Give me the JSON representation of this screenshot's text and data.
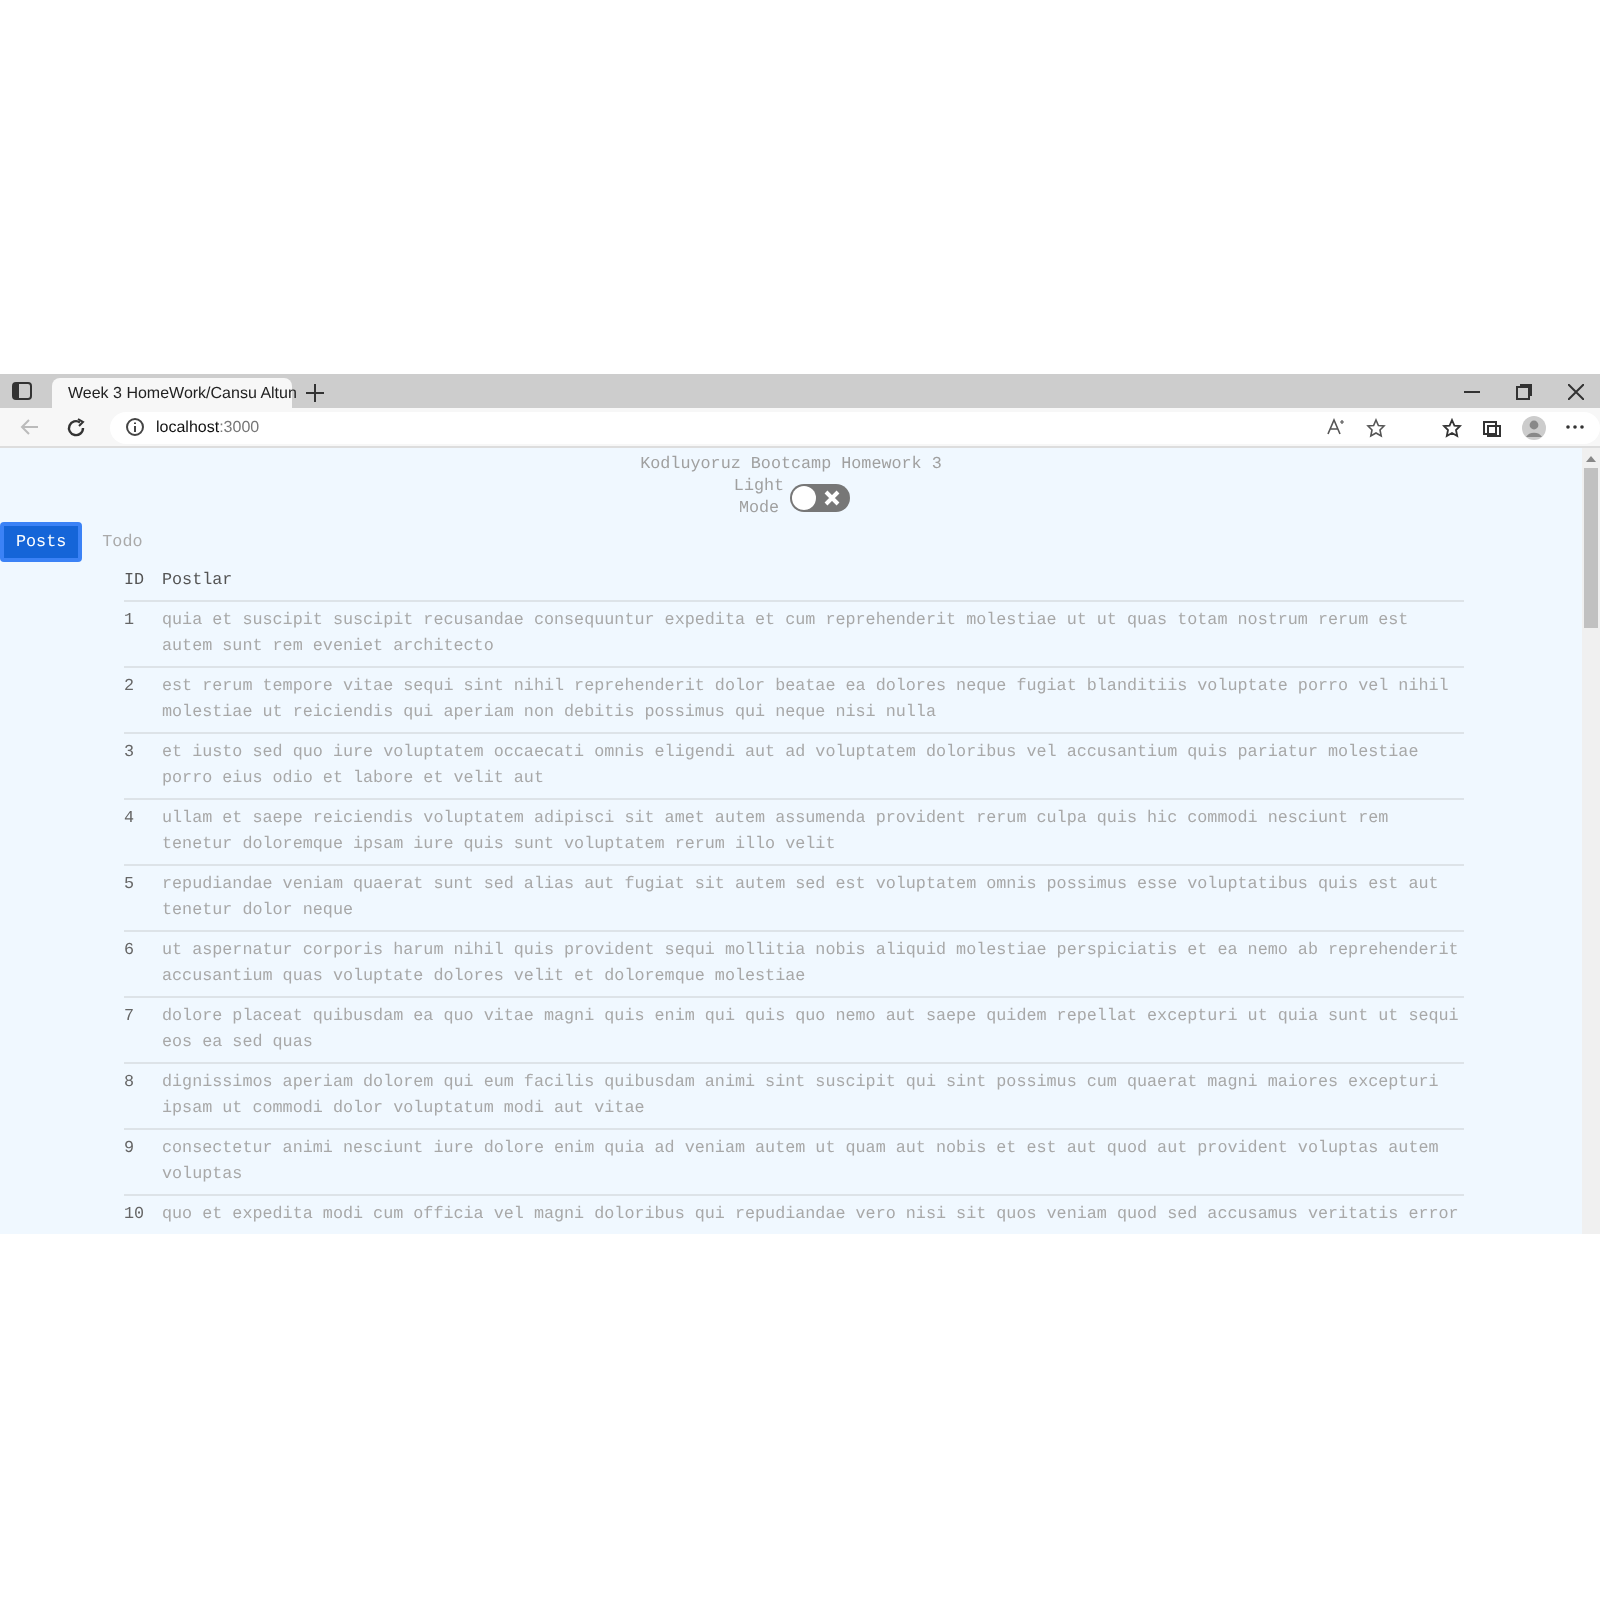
{
  "browser": {
    "tab_title": "Week 3 HomeWork/Cansu Altun",
    "address_host": "localhost",
    "address_port": ":3000"
  },
  "page": {
    "title": "Kodluyoruz Bootcamp Homework 3",
    "theme_toggle": {
      "label": "Light Mode",
      "on": false
    }
  },
  "tabs": [
    {
      "label": "Posts",
      "selected": true
    },
    {
      "label": "Todo",
      "selected": false
    }
  ],
  "table": {
    "columns": [
      "ID",
      "Postlar"
    ],
    "rows": [
      {
        "id": "1",
        "text": "quia et suscipit suscipit recusandae consequuntur expedita et cum reprehenderit molestiae ut ut quas totam nostrum rerum est autem sunt rem eveniet architecto"
      },
      {
        "id": "2",
        "text": "est rerum tempore vitae sequi sint nihil reprehenderit dolor beatae ea dolores neque fugiat blanditiis voluptate porro vel nihil molestiae ut reiciendis qui aperiam non debitis possimus qui neque nisi nulla"
      },
      {
        "id": "3",
        "text": "et iusto sed quo iure voluptatem occaecati omnis eligendi aut ad voluptatem doloribus vel accusantium quis pariatur molestiae porro eius odio et labore et velit aut"
      },
      {
        "id": "4",
        "text": "ullam et saepe reiciendis voluptatem adipisci sit amet autem assumenda provident rerum culpa quis hic commodi nesciunt rem tenetur doloremque ipsam iure quis sunt voluptatem rerum illo velit"
      },
      {
        "id": "5",
        "text": "repudiandae veniam quaerat sunt sed alias aut fugiat sit autem sed est voluptatem omnis possimus esse voluptatibus quis est aut tenetur dolor neque"
      },
      {
        "id": "6",
        "text": "ut aspernatur corporis harum nihil quis provident sequi mollitia nobis aliquid molestiae perspiciatis et ea nemo ab reprehenderit accusantium quas voluptate dolores velit et doloremque molestiae"
      },
      {
        "id": "7",
        "text": "dolore placeat quibusdam ea quo vitae magni quis enim qui quis quo nemo aut saepe quidem repellat excepturi ut quia sunt ut sequi eos ea sed quas"
      },
      {
        "id": "8",
        "text": "dignissimos aperiam dolorem qui eum facilis quibusdam animi sint suscipit qui sint possimus cum quaerat magni maiores excepturi ipsam ut commodi dolor voluptatum modi aut vitae"
      },
      {
        "id": "9",
        "text": "consectetur animi nesciunt iure dolore enim quia ad veniam autem ut quam aut nobis et est aut quod aut provident voluptas autem voluptas"
      },
      {
        "id": "10",
        "text": "quo et expedita modi cum officia vel magni doloribus qui repudiandae vero nisi sit quos veniam quod sed accusamus veritatis error"
      }
    ]
  }
}
